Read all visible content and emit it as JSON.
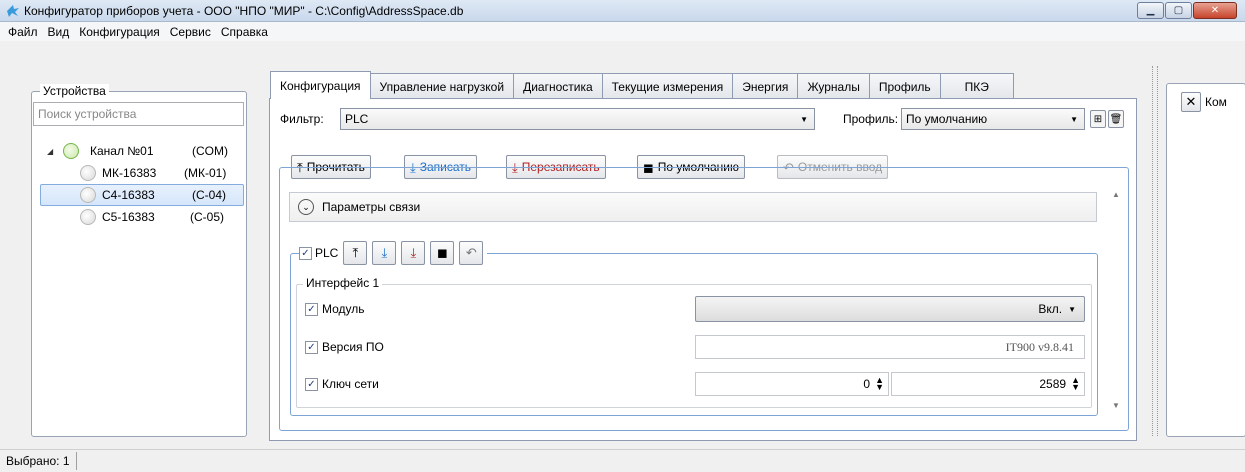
{
  "window": {
    "title": "Конфигуратор приборов учета - ООО \"НПО \"МИР\" - C:\\Config\\AddressSpace.db",
    "minimize_icon": "minimize-icon",
    "maximize_icon": "maximize-icon",
    "close_icon": "close-icon"
  },
  "menu": [
    "Файл",
    "Вид",
    "Конфигурация",
    "Сервис",
    "Справка"
  ],
  "devices": {
    "title": "Устройства",
    "search_placeholder": "Поиск устройства",
    "tree": [
      {
        "name": "Канал №01",
        "tag": "(COM)",
        "status": "green",
        "expanded": true
      },
      {
        "name": "МК-16383",
        "tag": "(МК-01)",
        "status": "gray"
      },
      {
        "name": "С4-16383",
        "tag": "(С-04)",
        "status": "gray",
        "selected": true
      },
      {
        "name": "С5-16383",
        "tag": "(С-05)",
        "status": "gray"
      }
    ]
  },
  "tabs": [
    "Конфигурация",
    "Управление нагрузкой",
    "Диагностика",
    "Текущие измерения",
    "Энергия",
    "Журналы",
    "Профиль",
    "ПКЭ"
  ],
  "active_tab": "Конфигурация",
  "filter": {
    "label": "Фильтр:",
    "value": "PLC",
    "profile_label": "Профиль:",
    "profile_value": "По умолчанию"
  },
  "toolbar": {
    "read": "Прочитать",
    "write": "Записать",
    "overwrite": "Перезаписать",
    "default": "По умолчанию",
    "undo": "Отменить ввод"
  },
  "section": {
    "comm_params": "Параметры связи",
    "plc_label": "PLC",
    "interface_title": "Интерфейс 1",
    "params": [
      {
        "label": "Модуль",
        "checked": true,
        "value": "Вкл."
      },
      {
        "label": "Версия ПО",
        "checked": true,
        "value": "IT900 v9.8.41"
      },
      {
        "label": "Ключ сети",
        "checked": true,
        "value1": "0",
        "value2": "2589"
      }
    ]
  },
  "right_panel": {
    "title": "Ком"
  },
  "status": {
    "selected": "Выбрано: 1"
  },
  "colors": {
    "accent_blue": "#1a6fc9",
    "danger_red": "#b32020",
    "group_border": "#7ea4d6"
  }
}
